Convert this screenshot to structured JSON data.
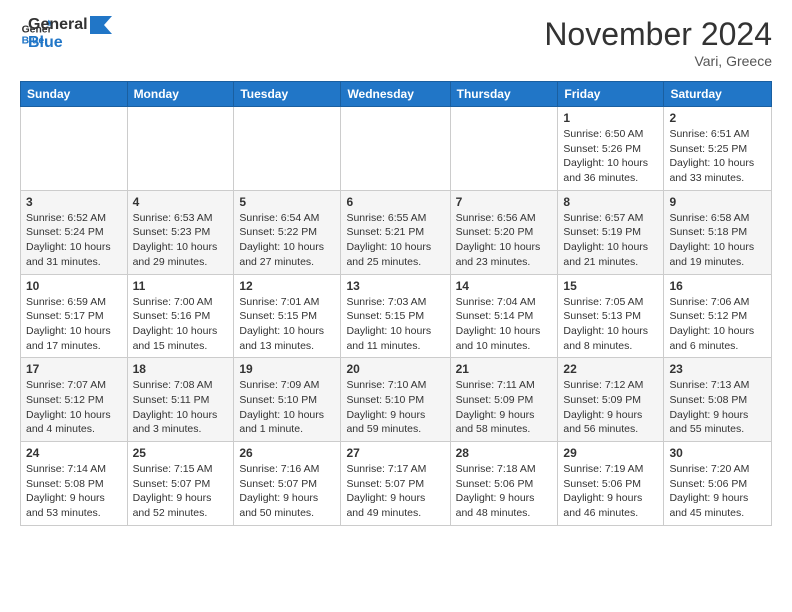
{
  "header": {
    "logo_line1": "General",
    "logo_line2": "Blue",
    "month": "November 2024",
    "location": "Vari, Greece"
  },
  "weekdays": [
    "Sunday",
    "Monday",
    "Tuesday",
    "Wednesday",
    "Thursday",
    "Friday",
    "Saturday"
  ],
  "weeks": [
    [
      {
        "day": "",
        "info": ""
      },
      {
        "day": "",
        "info": ""
      },
      {
        "day": "",
        "info": ""
      },
      {
        "day": "",
        "info": ""
      },
      {
        "day": "",
        "info": ""
      },
      {
        "day": "1",
        "info": "Sunrise: 6:50 AM\nSunset: 5:26 PM\nDaylight: 10 hours and 36 minutes."
      },
      {
        "day": "2",
        "info": "Sunrise: 6:51 AM\nSunset: 5:25 PM\nDaylight: 10 hours and 33 minutes."
      }
    ],
    [
      {
        "day": "3",
        "info": "Sunrise: 6:52 AM\nSunset: 5:24 PM\nDaylight: 10 hours and 31 minutes."
      },
      {
        "day": "4",
        "info": "Sunrise: 6:53 AM\nSunset: 5:23 PM\nDaylight: 10 hours and 29 minutes."
      },
      {
        "day": "5",
        "info": "Sunrise: 6:54 AM\nSunset: 5:22 PM\nDaylight: 10 hours and 27 minutes."
      },
      {
        "day": "6",
        "info": "Sunrise: 6:55 AM\nSunset: 5:21 PM\nDaylight: 10 hours and 25 minutes."
      },
      {
        "day": "7",
        "info": "Sunrise: 6:56 AM\nSunset: 5:20 PM\nDaylight: 10 hours and 23 minutes."
      },
      {
        "day": "8",
        "info": "Sunrise: 6:57 AM\nSunset: 5:19 PM\nDaylight: 10 hours and 21 minutes."
      },
      {
        "day": "9",
        "info": "Sunrise: 6:58 AM\nSunset: 5:18 PM\nDaylight: 10 hours and 19 minutes."
      }
    ],
    [
      {
        "day": "10",
        "info": "Sunrise: 6:59 AM\nSunset: 5:17 PM\nDaylight: 10 hours and 17 minutes."
      },
      {
        "day": "11",
        "info": "Sunrise: 7:00 AM\nSunset: 5:16 PM\nDaylight: 10 hours and 15 minutes."
      },
      {
        "day": "12",
        "info": "Sunrise: 7:01 AM\nSunset: 5:15 PM\nDaylight: 10 hours and 13 minutes."
      },
      {
        "day": "13",
        "info": "Sunrise: 7:03 AM\nSunset: 5:15 PM\nDaylight: 10 hours and 11 minutes."
      },
      {
        "day": "14",
        "info": "Sunrise: 7:04 AM\nSunset: 5:14 PM\nDaylight: 10 hours and 10 minutes."
      },
      {
        "day": "15",
        "info": "Sunrise: 7:05 AM\nSunset: 5:13 PM\nDaylight: 10 hours and 8 minutes."
      },
      {
        "day": "16",
        "info": "Sunrise: 7:06 AM\nSunset: 5:12 PM\nDaylight: 10 hours and 6 minutes."
      }
    ],
    [
      {
        "day": "17",
        "info": "Sunrise: 7:07 AM\nSunset: 5:12 PM\nDaylight: 10 hours and 4 minutes."
      },
      {
        "day": "18",
        "info": "Sunrise: 7:08 AM\nSunset: 5:11 PM\nDaylight: 10 hours and 3 minutes."
      },
      {
        "day": "19",
        "info": "Sunrise: 7:09 AM\nSunset: 5:10 PM\nDaylight: 10 hours and 1 minute."
      },
      {
        "day": "20",
        "info": "Sunrise: 7:10 AM\nSunset: 5:10 PM\nDaylight: 9 hours and 59 minutes."
      },
      {
        "day": "21",
        "info": "Sunrise: 7:11 AM\nSunset: 5:09 PM\nDaylight: 9 hours and 58 minutes."
      },
      {
        "day": "22",
        "info": "Sunrise: 7:12 AM\nSunset: 5:09 PM\nDaylight: 9 hours and 56 minutes."
      },
      {
        "day": "23",
        "info": "Sunrise: 7:13 AM\nSunset: 5:08 PM\nDaylight: 9 hours and 55 minutes."
      }
    ],
    [
      {
        "day": "24",
        "info": "Sunrise: 7:14 AM\nSunset: 5:08 PM\nDaylight: 9 hours and 53 minutes."
      },
      {
        "day": "25",
        "info": "Sunrise: 7:15 AM\nSunset: 5:07 PM\nDaylight: 9 hours and 52 minutes."
      },
      {
        "day": "26",
        "info": "Sunrise: 7:16 AM\nSunset: 5:07 PM\nDaylight: 9 hours and 50 minutes."
      },
      {
        "day": "27",
        "info": "Sunrise: 7:17 AM\nSunset: 5:07 PM\nDaylight: 9 hours and 49 minutes."
      },
      {
        "day": "28",
        "info": "Sunrise: 7:18 AM\nSunset: 5:06 PM\nDaylight: 9 hours and 48 minutes."
      },
      {
        "day": "29",
        "info": "Sunrise: 7:19 AM\nSunset: 5:06 PM\nDaylight: 9 hours and 46 minutes."
      },
      {
        "day": "30",
        "info": "Sunrise: 7:20 AM\nSunset: 5:06 PM\nDaylight: 9 hours and 45 minutes."
      }
    ]
  ]
}
